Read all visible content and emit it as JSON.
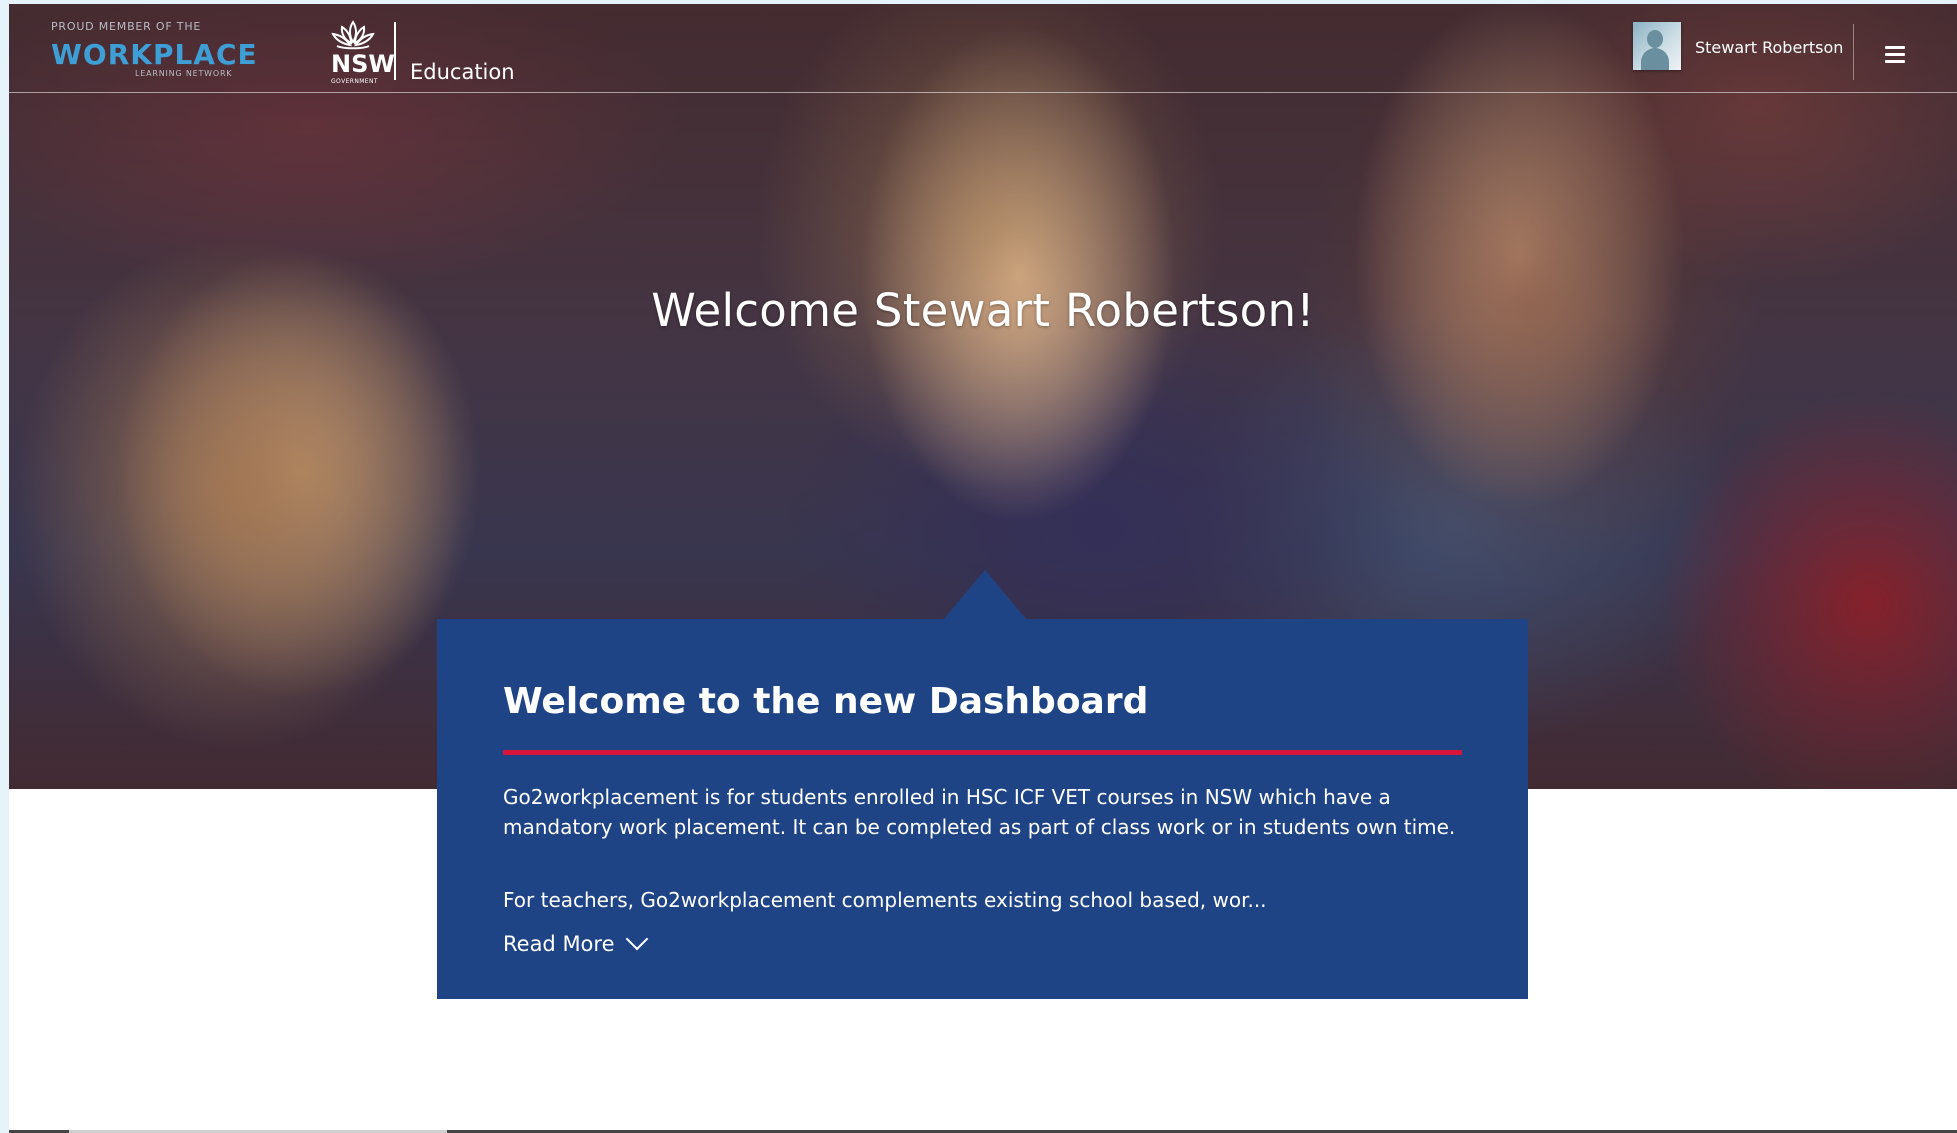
{
  "header": {
    "workplace_logo": {
      "top_line": "PROUD MEMBER OF THE",
      "main": "WORKPLACE",
      "sub": "LEARNING NETWORK"
    },
    "nsw_logo": {
      "text": "NSW",
      "sub": "GOVERNMENT"
    },
    "department_label": "Education",
    "user": {
      "name": "Stewart Robertson"
    },
    "menu_icon": "hamburger-menu-icon"
  },
  "hero": {
    "title": "Welcome Stewart Robertson!"
  },
  "dashboard_card": {
    "title": "Welcome to the new Dashboard",
    "paragraph_1": "Go2workplacement is for students enrolled in HSC ICF VET courses in NSW which have a mandatory work placement. It can be completed as part of class work or in students own time.",
    "paragraph_2": "For teachers, Go2workplacement complements existing school based, wor...",
    "read_more_label": "Read More",
    "read_more_icon": "chevron-down-icon"
  },
  "colors": {
    "card_background": "#1f4486",
    "accent_rule": "#d7153a",
    "logo_blue": "#3e9fd6"
  }
}
